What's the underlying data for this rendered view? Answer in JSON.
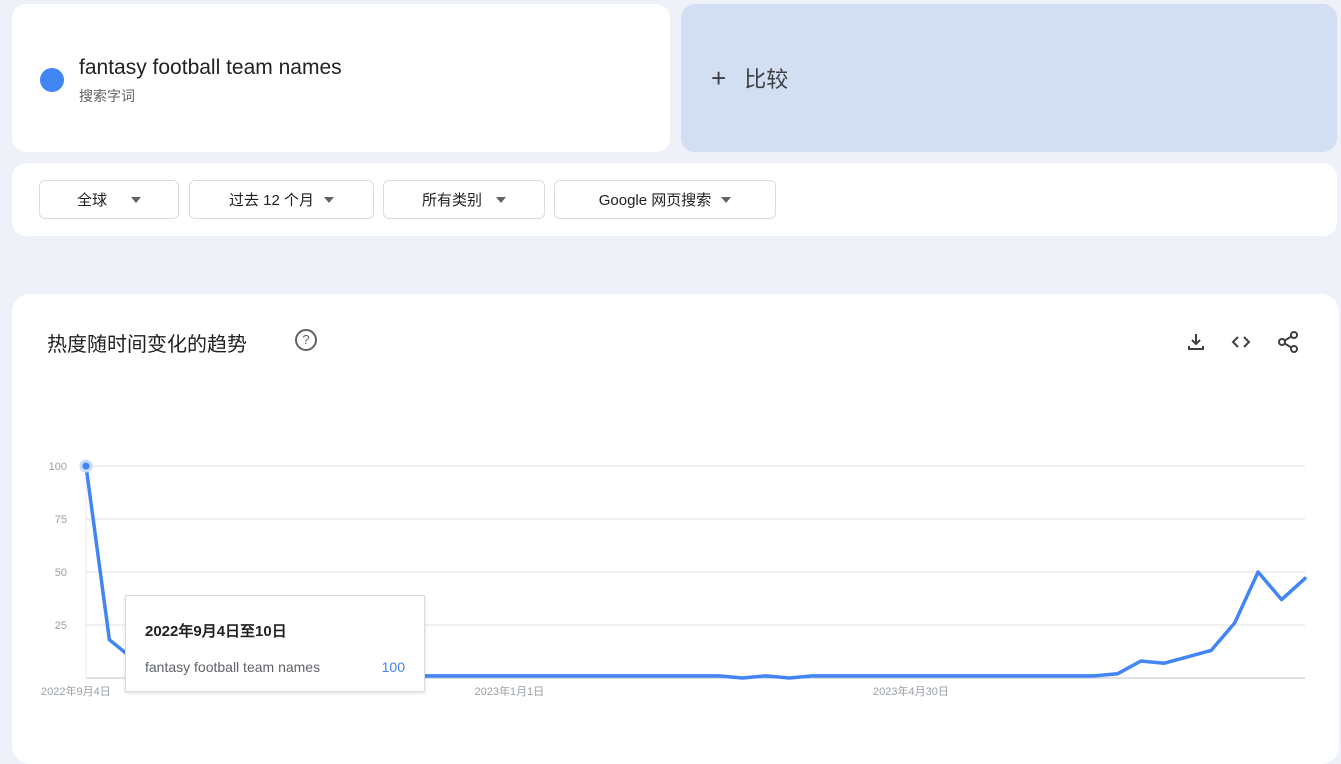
{
  "search_term": {
    "title": "fantasy football team names",
    "subtitle": "搜索字词",
    "color": "#4285f4"
  },
  "compare": {
    "plus": "+",
    "label": "比较"
  },
  "filters": [
    {
      "label": "全球"
    },
    {
      "label": "过去 12 个月"
    },
    {
      "label": "所有类别"
    },
    {
      "label": "Google 网页搜索"
    }
  ],
  "chart_section": {
    "title": "热度随时间变化的趋势",
    "help_icon": "question-mark-circle-icon",
    "tools": [
      "download-icon",
      "embed-code-icon",
      "share-icon"
    ]
  },
  "chart_data": {
    "type": "line",
    "ylim": [
      0,
      100
    ],
    "yticks": [
      "100",
      "75",
      "50",
      "25"
    ],
    "xtick_labels": [
      "2022年9月4日",
      "2023年1月1日",
      "2023年4月30日"
    ],
    "series": [
      {
        "name": "fantasy football team names",
        "color": "#4285f4",
        "values": [
          100,
          18,
          9,
          6,
          4,
          3,
          2,
          2,
          1,
          1,
          1,
          1,
          1,
          1,
          1,
          1,
          1,
          1,
          1,
          1,
          1,
          1,
          1,
          1,
          1,
          1,
          1,
          1,
          0,
          1,
          0,
          1,
          1,
          1,
          1,
          1,
          1,
          1,
          1,
          1,
          1,
          1,
          1,
          1,
          2,
          8,
          7,
          10,
          13,
          26,
          50,
          37,
          47
        ]
      }
    ]
  },
  "tooltip": {
    "date": "2022年9月4日至10日",
    "term": "fantasy football team names",
    "value": "100"
  }
}
